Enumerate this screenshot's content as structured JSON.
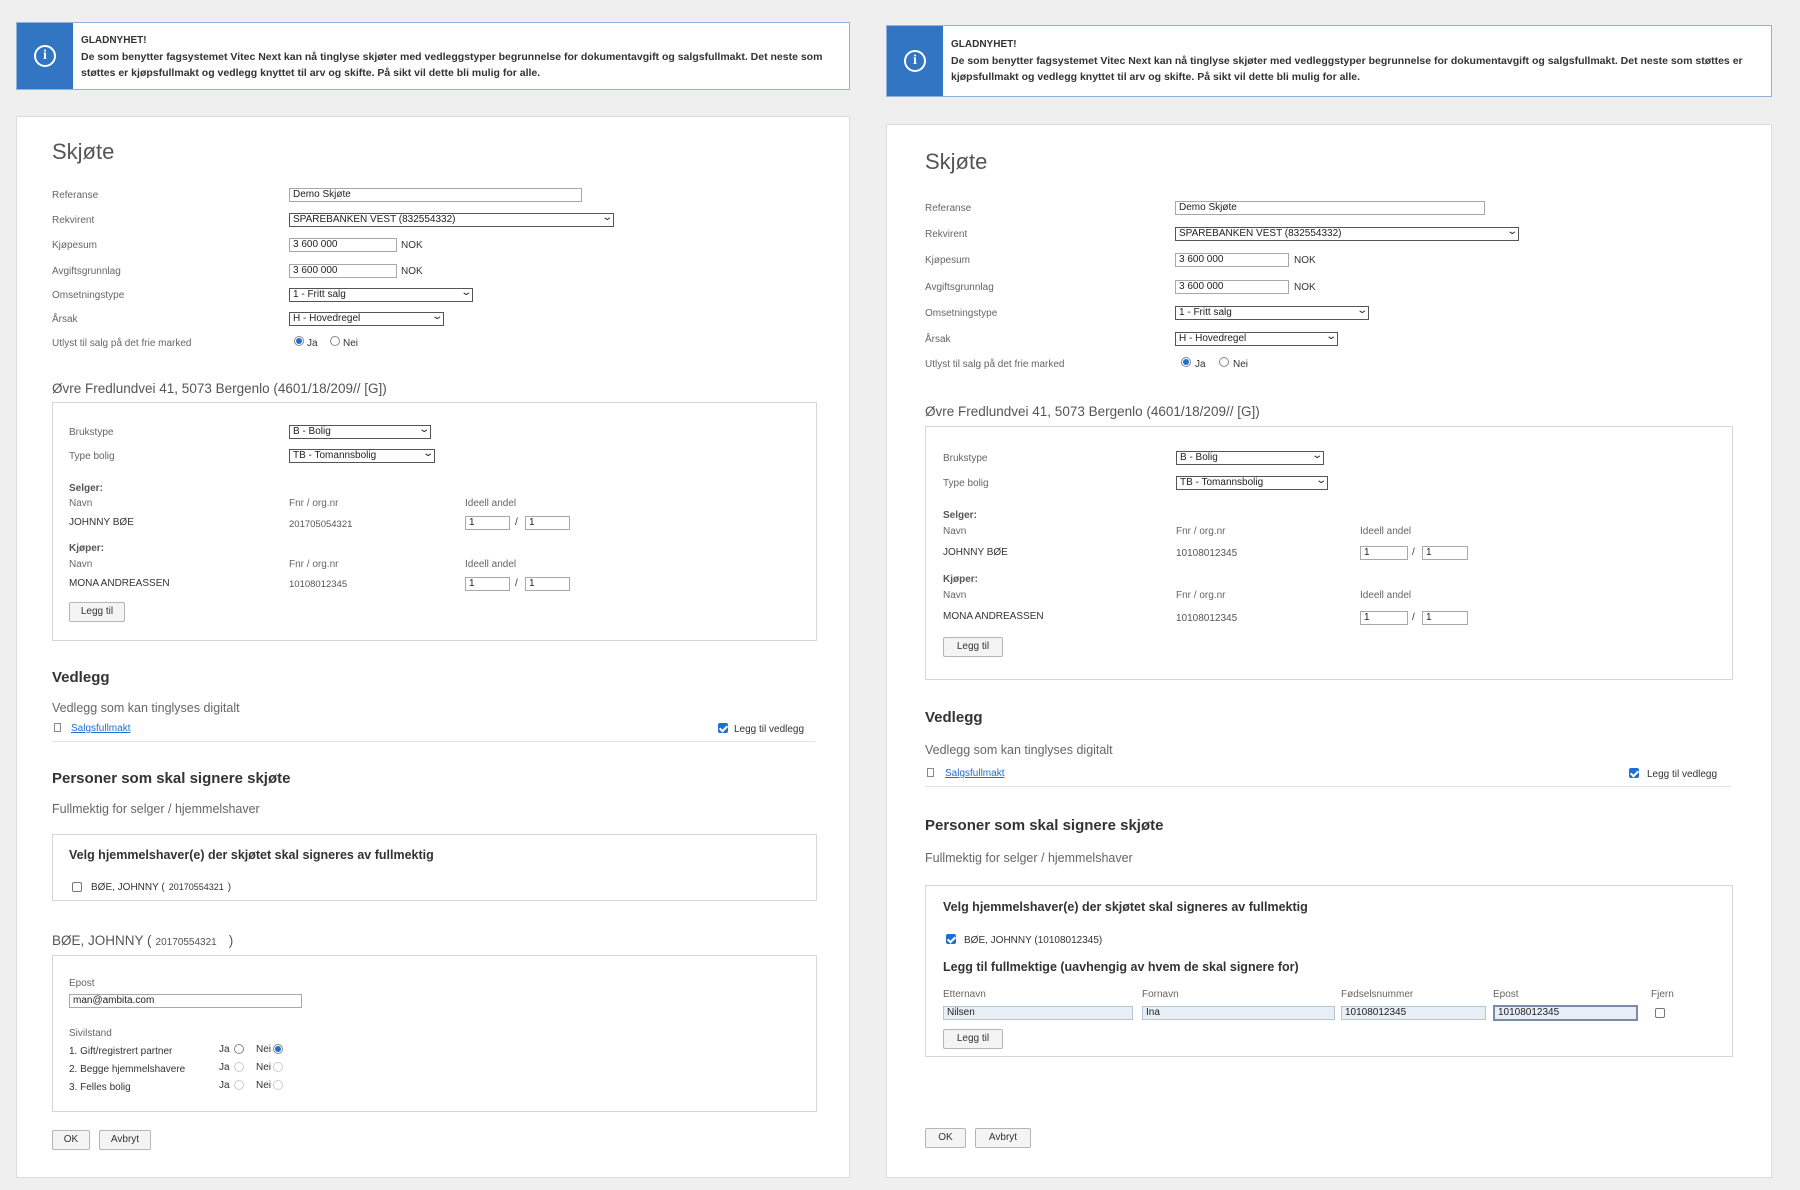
{
  "banner": {
    "title": "GLADNYHET!",
    "text": "De som benytter fagsystemet Vitec Next kan nå tinglyse skjøter med vedleggstyper begrunnelse for dokumentavgift og salgsfullmakt. Det neste som støttes er kjøpsfullmakt og vedlegg knyttet til arv og skifte. På sikt vil dette bli mulig for alle.",
    "icon": "info-icon"
  },
  "form": {
    "title": "Skjøte",
    "labels": {
      "referanse": "Referanse",
      "rekvirent": "Rekvirent",
      "kjopesum": "Kjøpesum",
      "avgiftsgrunnlag": "Avgiftsgrunnlag",
      "omsetningstype": "Omsetningstype",
      "arsak": "Årsak",
      "utlyst": "Utlyst til salg på det frie marked"
    },
    "referanse": "Demo Skjøte",
    "rekvirent": "SPAREBANKEN VEST (832554332)",
    "kjopesum": "3 600 000",
    "avgiftsgrunnlag": "3 600 000",
    "currency": "NOK",
    "omsetningstype": "1 - Fritt salg",
    "arsak": "H - Hovedregel",
    "ja": "Ja",
    "nei": "Nei"
  },
  "property": {
    "title": "Øvre Fredlundvei 41, 5073 Bergenlo (4601/18/209// [G])",
    "labels": {
      "brukstype": "Brukstype",
      "type_bolig": "Type bolig",
      "selger": "Selger:",
      "kjoper": "Kjøper:",
      "navn": "Navn",
      "fnr": "Fnr / org.nr",
      "ideell": "Ideell andel"
    },
    "brukstype": "B - Bolig",
    "type_bolig": "TB - Tomannsbolig",
    "seller_name": "JOHNNY BØE",
    "seller_fnr_left": "201705054321",
    "seller_fnr_right": "10108012345",
    "buyer_name": "MONA ANDREASSEN",
    "buyer_fnr": "10108012345",
    "share_num": "1",
    "share_den": "1",
    "share_slash": "/",
    "add_button": "Legg til"
  },
  "attachments": {
    "title": "Vedlegg",
    "subtitle": "Vedlegg som kan tinglyses digitalt",
    "item": "Salgsfullmakt",
    "add_checkbox": "Legg til vedlegg"
  },
  "signers": {
    "title": "Personer som skal signere skjøte",
    "subtitle": "Fullmektig for selger / hjemmelshaver",
    "box_title": "Velg hjemmelshaver(e) der skjøtet skal signeres av fullmektig",
    "person_left": "BØE, JOHNNY (",
    "person_left_fnr": "20170554321",
    "person_left_close": ")",
    "person_right": "BØE, JOHNNY (10108012345)",
    "add_title": "Legg til fullmektige (uavhengig av hvem de skal signere for)",
    "columns": [
      "Etternavn",
      "Fornavn",
      "Fødselsnummer",
      "Epost",
      "Fjern"
    ],
    "row": [
      "Nilsen",
      "Ina",
      "10108012345",
      "10108012345"
    ],
    "add_button": "Legg til"
  },
  "person": {
    "heading": "BØE, JOHNNY (",
    "fnr": "20170554321",
    "close": ")",
    "epost_label": "Epost",
    "epost": "man@ambita.com",
    "sivilstand_label": "Sivilstand",
    "rows": [
      "1. Gift/registrert partner",
      "2. Begge hjemmelshavere",
      "3. Felles bolig"
    ],
    "ja": "Ja",
    "nei": "Nei"
  },
  "actions": {
    "ok": "OK",
    "cancel": "Avbryt"
  },
  "colors": {
    "accent": "#3276c3",
    "check": "#1b6fd6"
  }
}
